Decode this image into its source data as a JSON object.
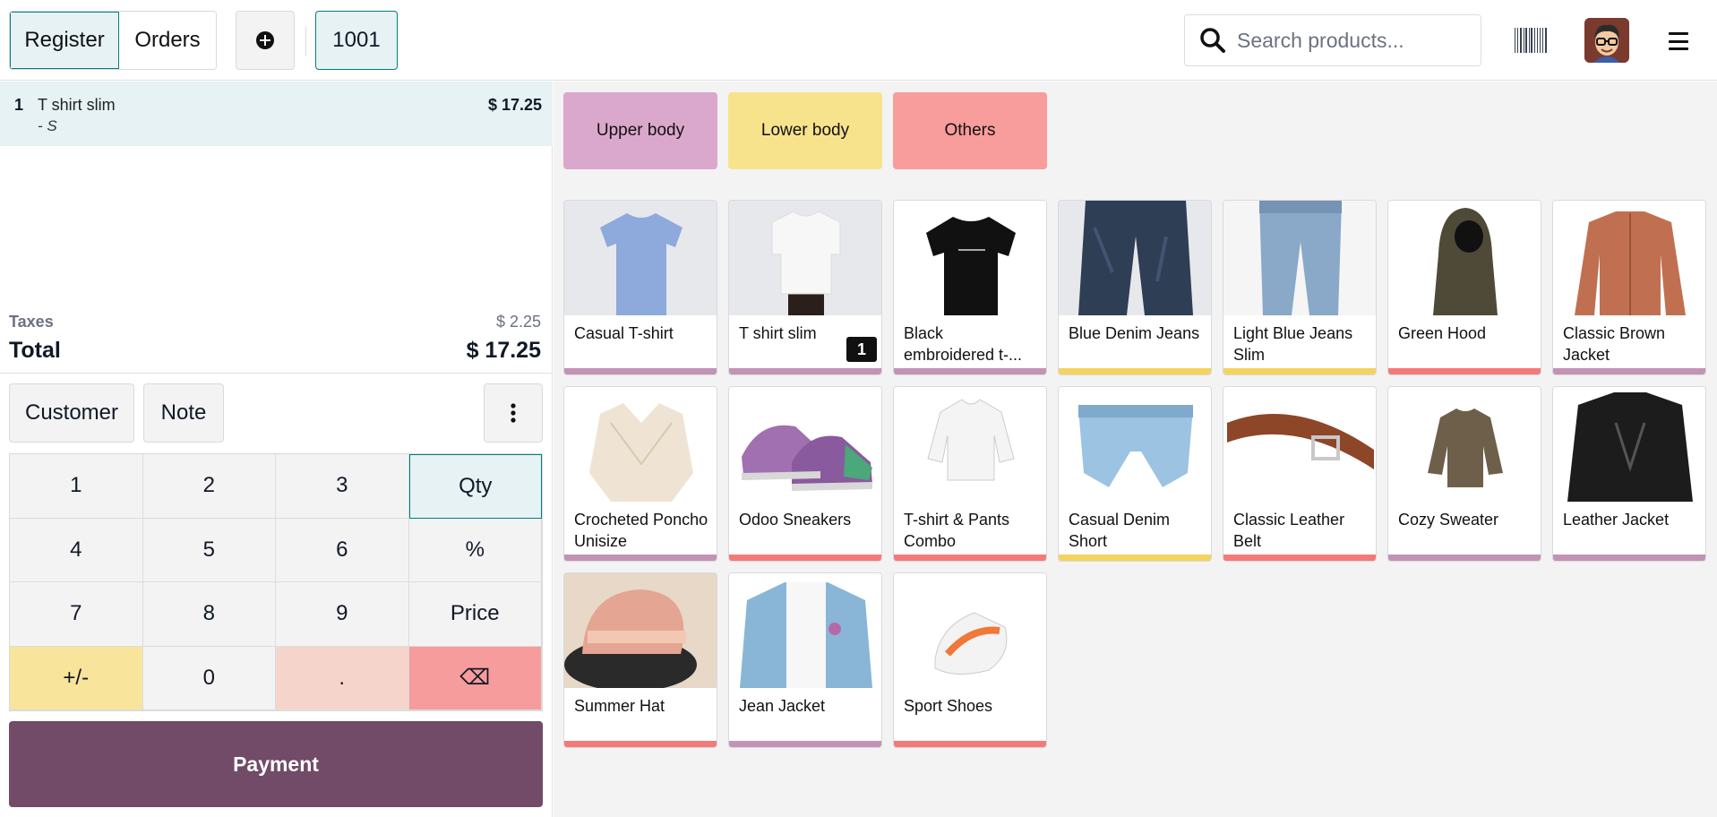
{
  "topbar": {
    "register_label": "Register",
    "orders_label": "Orders",
    "order_number": "1001",
    "search_placeholder": "Search products..."
  },
  "order": {
    "lines": [
      {
        "qty": "1",
        "name": "T shirt slim",
        "variant": "- S",
        "price": "$ 17.25"
      }
    ],
    "taxes_label": "Taxes",
    "taxes_value": "$ 2.25",
    "total_label": "Total",
    "total_value": "$ 17.25"
  },
  "controls": {
    "customer_label": "Customer",
    "note_label": "Note"
  },
  "numpad": [
    "1",
    "2",
    "3",
    "Qty",
    "4",
    "5",
    "6",
    "%",
    "7",
    "8",
    "9",
    "Price",
    "+/-",
    "0",
    ".",
    "⌫"
  ],
  "payment_label": "Payment",
  "categories": [
    {
      "label": "Upper body",
      "color": "#dba8cd"
    },
    {
      "label": "Lower body",
      "color": "#f8e38d"
    },
    {
      "label": "Others",
      "color": "#f99c9c"
    }
  ],
  "colors": {
    "accent": "#017e84",
    "payment": "#714b67",
    "upper_body": "#c293b5",
    "lower_body": "#f4d35e",
    "others": "#f47a7a"
  },
  "products": [
    {
      "name": "Casual T-shirt",
      "category": "upper"
    },
    {
      "name": "T shirt slim",
      "category": "upper",
      "badge": "1"
    },
    {
      "name": "Black embroidered t-...",
      "category": "upper"
    },
    {
      "name": "Blue Denim Jeans",
      "category": "lower"
    },
    {
      "name": "Light Blue Jeans Slim",
      "category": "lower"
    },
    {
      "name": "Green Hood",
      "category": "others"
    },
    {
      "name": "Classic Brown Jacket",
      "category": "upper"
    },
    {
      "name": "Crocheted Poncho Unisize",
      "category": "upper"
    },
    {
      "name": "Odoo Sneakers",
      "category": "others"
    },
    {
      "name": "T-shirt & Pants Combo",
      "category": "others"
    },
    {
      "name": "Casual Denim Short",
      "category": "lower"
    },
    {
      "name": "Classic Leather Belt",
      "category": "others"
    },
    {
      "name": "Cozy Sweater",
      "category": "upper"
    },
    {
      "name": "Leather Jacket",
      "category": "upper"
    },
    {
      "name": "Summer Hat",
      "category": "others"
    },
    {
      "name": "Jean Jacket",
      "category": "upper"
    },
    {
      "name": "Sport Shoes",
      "category": "others"
    }
  ]
}
